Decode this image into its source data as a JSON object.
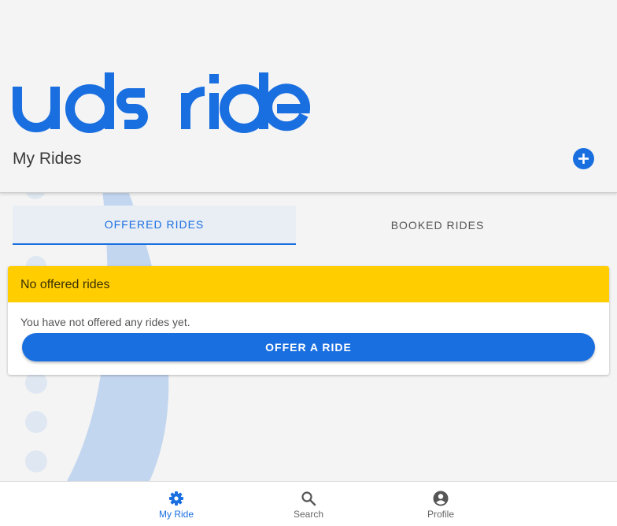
{
  "header": {
    "logo_alt": "uds ride",
    "title": "My Rides",
    "add_icon": "plus-circle-icon"
  },
  "tabs": [
    {
      "label": "OFFERED RIDES",
      "active": true
    },
    {
      "label": "BOOKED RIDES",
      "active": false
    }
  ],
  "card": {
    "title": "No offered rides",
    "message": "You have not offered any rides yet.",
    "button_label": "OFFER A RIDE"
  },
  "bottom_nav": [
    {
      "label": "My Ride",
      "icon": "gear-icon",
      "active": true
    },
    {
      "label": "Search",
      "icon": "search-icon",
      "active": false
    },
    {
      "label": "Profile",
      "icon": "account-circle-icon",
      "active": false
    }
  ],
  "colors": {
    "primary": "#1a6fe0",
    "card_header": "#ffcd00",
    "background": "#f4f4f4"
  }
}
